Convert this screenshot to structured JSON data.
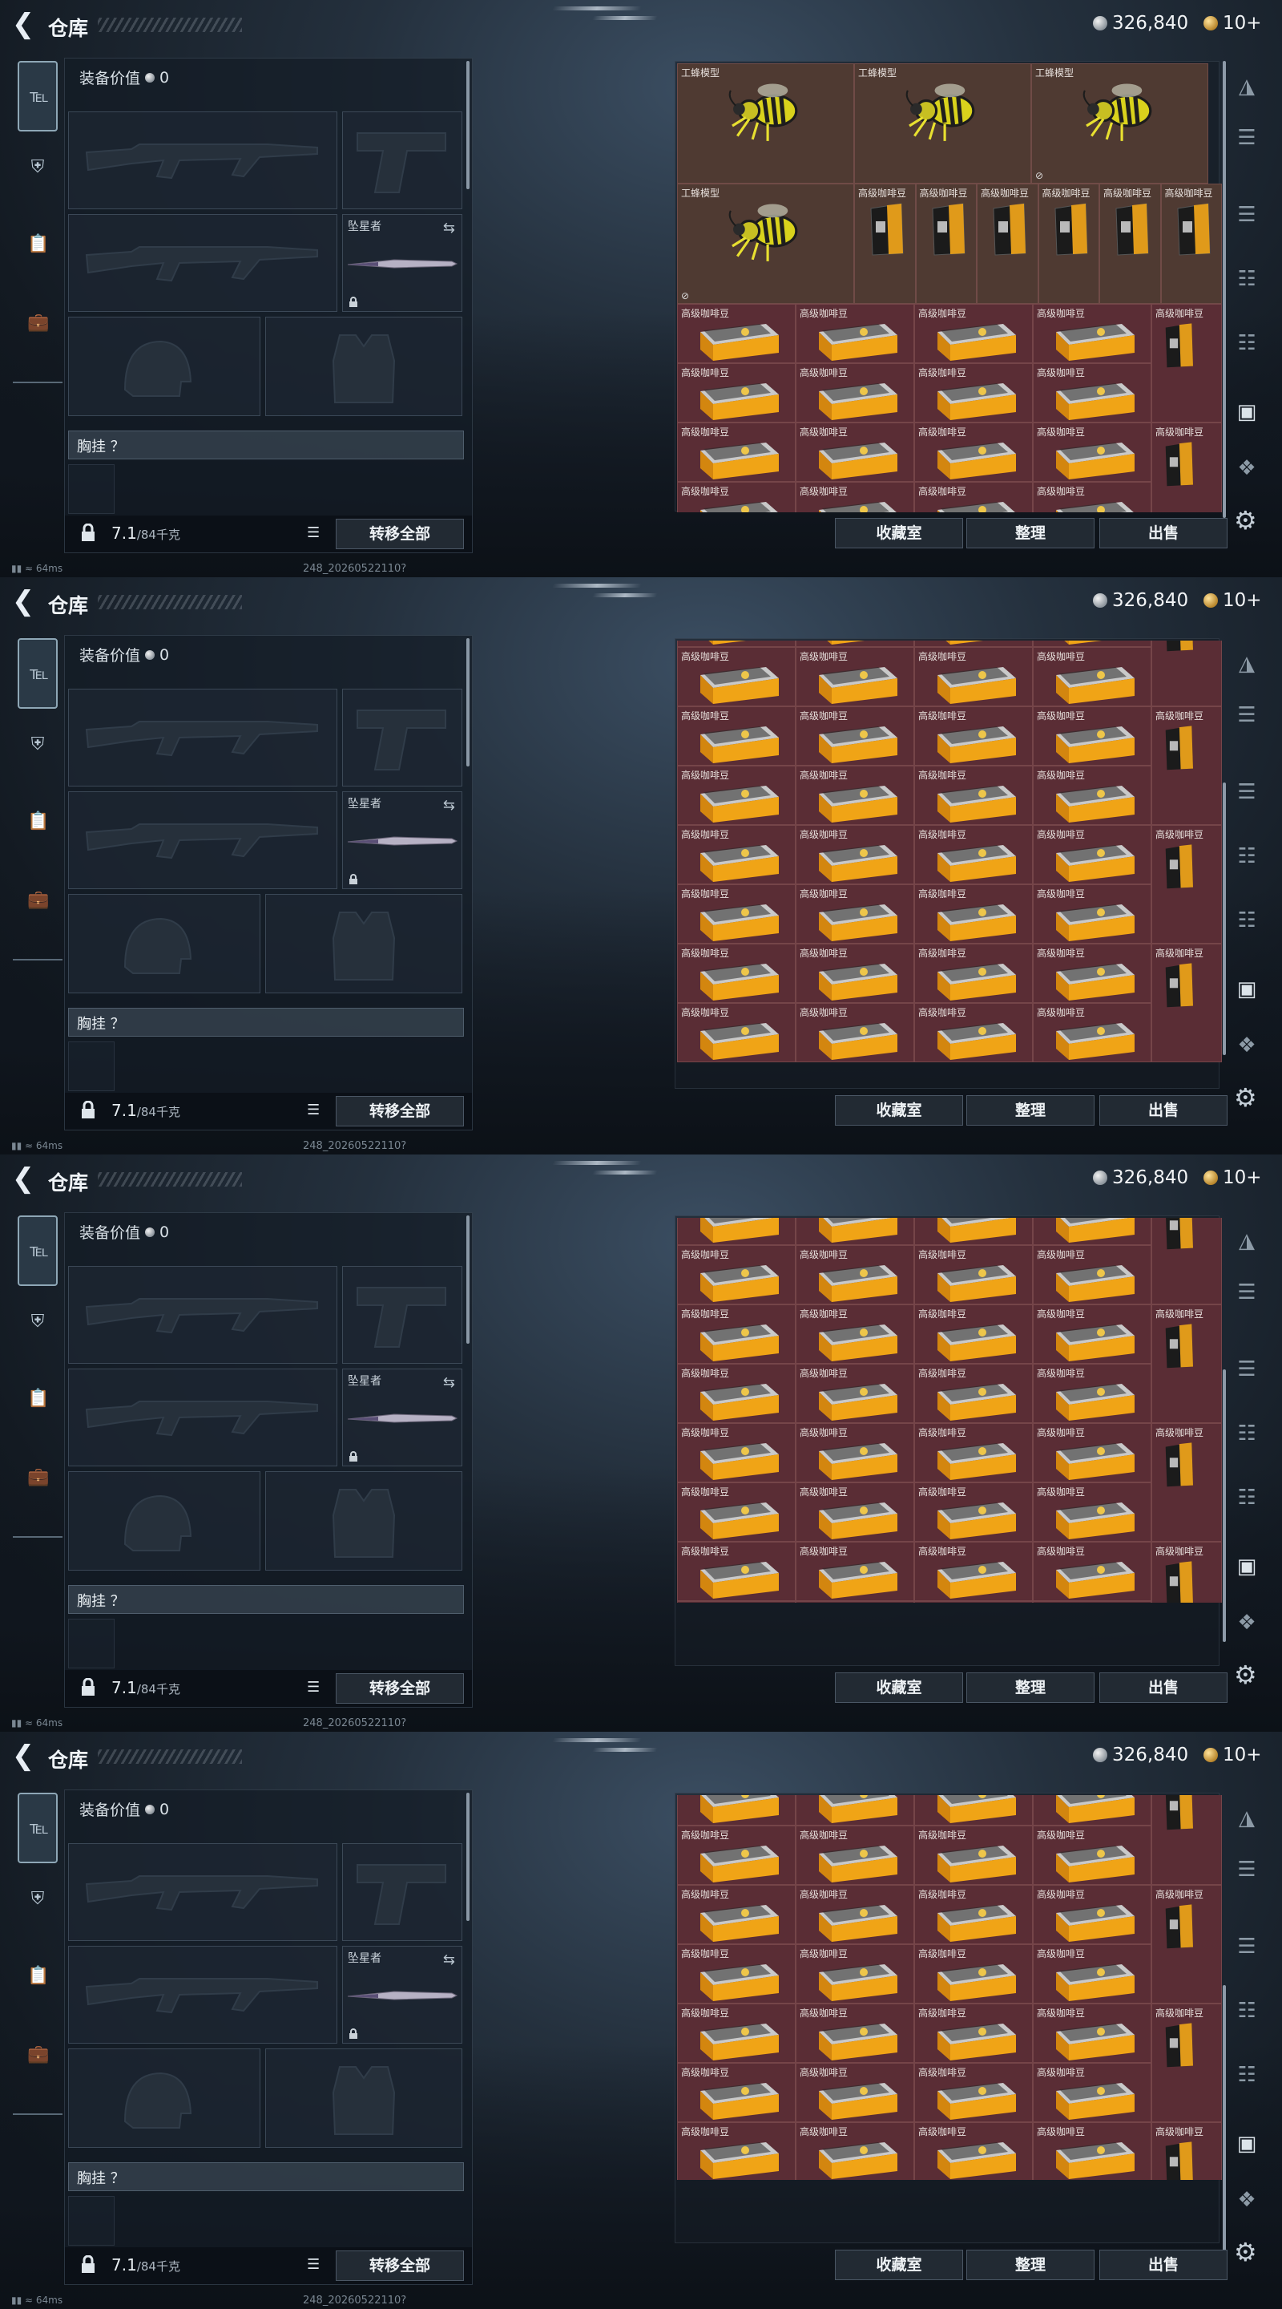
{
  "app": {
    "title": "仓库",
    "back_icon": "back-arrow-icon"
  },
  "currency": {
    "silver": "326,840",
    "gold": "10+"
  },
  "sidenav": {
    "items": [
      "pistol-icon",
      "armor-icon",
      "clipboard-icon",
      "briefcase-icon"
    ]
  },
  "left": {
    "equip_value_label": "装备价值",
    "equip_value": "0",
    "melee_name": "坠星者",
    "chest_label": "胸挂 ？",
    "weight": "7.1",
    "weight_max": "/84千克",
    "transfer_all": "转移全部"
  },
  "item_names": {
    "bee": "工蜂模型",
    "coffee": "高级咖啡豆"
  },
  "buttons": {
    "collection": "收藏室",
    "sort": "整理",
    "sell": "出售"
  },
  "status": {
    "ping": "64ms",
    "version": "248_20260522110?"
  },
  "colors": {
    "cell_brown": "#4f3a32",
    "cell_red": "#5a2d35"
  }
}
